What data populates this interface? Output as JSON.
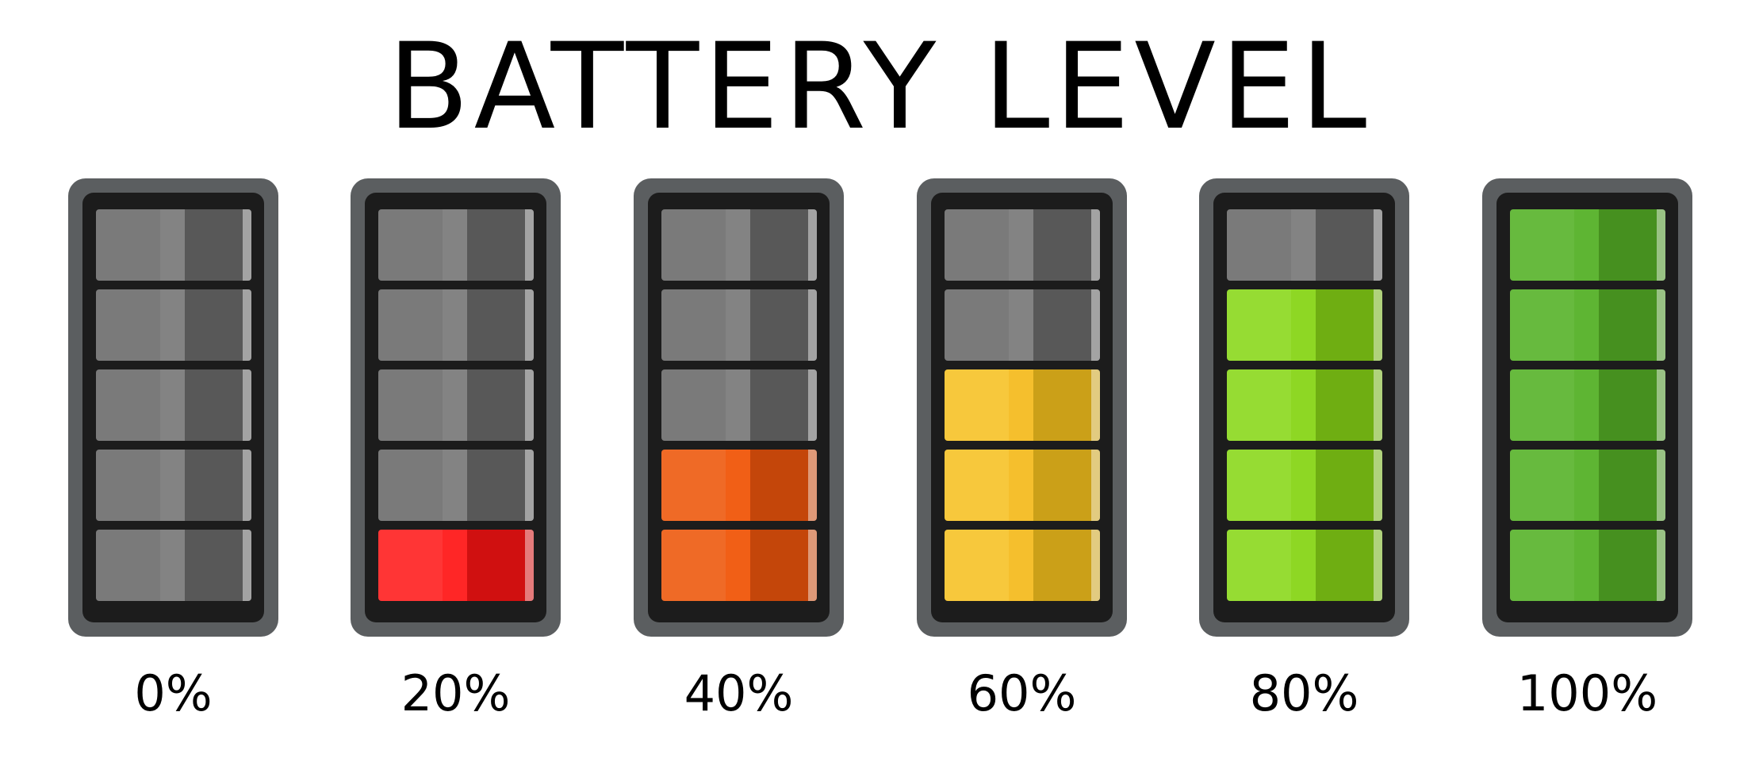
{
  "title": "BATTERY LEVEL",
  "colors": {
    "empty": [
      "#7a7a7a",
      "#585858",
      "#8a8a8a"
    ],
    "red": [
      "#ff3535",
      "#d01010",
      "#ff1a1a"
    ],
    "orange": [
      "#ef6a26",
      "#c4460a",
      "#f2560a"
    ],
    "yellow": [
      "#f7c83c",
      "#cba018",
      "#f4b820"
    ],
    "light-green": [
      "#96dc33",
      "#6fae12",
      "#88d418"
    ],
    "green": [
      "#67ba3e",
      "#46901f",
      "#58b02a"
    ]
  },
  "batteries": [
    {
      "label": "0%",
      "level": 0,
      "fill_color": "empty"
    },
    {
      "label": "20%",
      "level": 20,
      "fill_color": "red"
    },
    {
      "label": "40%",
      "level": 40,
      "fill_color": "orange"
    },
    {
      "label": "60%",
      "level": 60,
      "fill_color": "yellow"
    },
    {
      "label": "80%",
      "level": 80,
      "fill_color": "light-green"
    },
    {
      "label": "100%",
      "level": 100,
      "fill_color": "green"
    }
  ]
}
